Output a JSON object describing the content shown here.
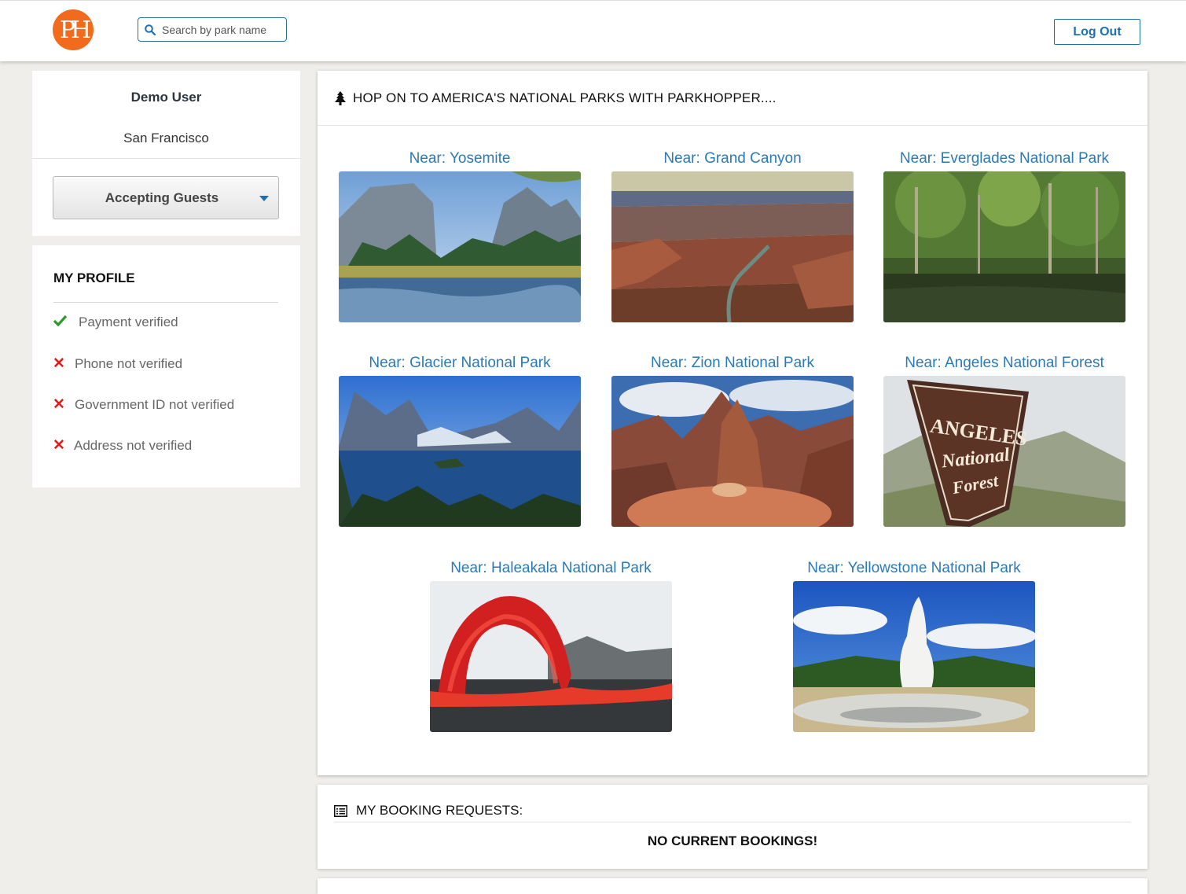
{
  "header": {
    "logo_text": "PH",
    "search_placeholder": "Search by park name",
    "logout_label": "Log Out"
  },
  "user": {
    "name": "Demo User",
    "city": "San Francisco",
    "status": "Accepting Guests"
  },
  "profile": {
    "title": "MY PROFILE",
    "items": [
      {
        "label": "Payment verified",
        "verified": true
      },
      {
        "label": "Phone not verified",
        "verified": false
      },
      {
        "label": "Government ID not verified",
        "verified": false
      },
      {
        "label": "Address not verified",
        "verified": false
      }
    ]
  },
  "main": {
    "title": "HOP ON TO AMERICA'S NATIONAL PARKS WITH PARKHOPPER....",
    "parks": [
      {
        "label": "Near: Yosemite"
      },
      {
        "label": "Near: Grand Canyon"
      },
      {
        "label": "Near: Everglades National Park"
      },
      {
        "label": "Near: Glacier National Park"
      },
      {
        "label": "Near: Zion National Park"
      },
      {
        "label": "Near: Angeles National Forest",
        "sign_text_1": "ANGELES",
        "sign_text_2": "National",
        "sign_text_3": "Forest"
      },
      {
        "label": "Near: Haleakala National Park"
      },
      {
        "label": "Near: Yellowstone National Park"
      }
    ]
  },
  "bookings": {
    "title": "MY BOOKING REQUESTS:",
    "empty_text": "NO CURRENT BOOKINGS!"
  },
  "colors": {
    "accent": "#1f6fae",
    "link": "#2a7ab8",
    "logo": "#f26a1b",
    "ok": "#2a9a2a",
    "error": "#e41b1b"
  }
}
